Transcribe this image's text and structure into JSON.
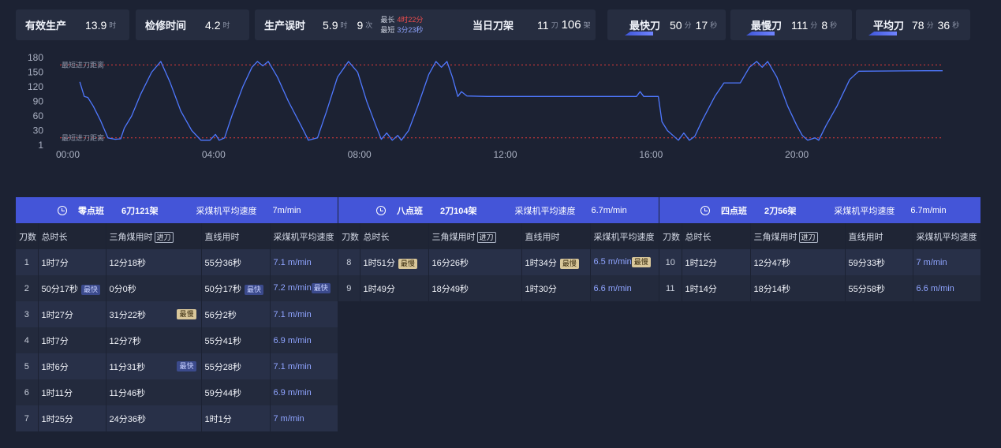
{
  "stats": {
    "effective": {
      "label": "有效生产",
      "value": "13.9",
      "unit": "时"
    },
    "maintenance": {
      "label": "检修时间",
      "value": "4.2",
      "unit": "时"
    },
    "delay": {
      "label": "生产误时",
      "value": "5.9",
      "unit": "时",
      "count": "9",
      "count_unit": "次",
      "longest_label": "最长",
      "longest": "4时22分",
      "shortest_label": "最短",
      "shortest": "3分23秒"
    },
    "today": {
      "label": "当日刀架",
      "knives": "11",
      "knives_unit": "刀",
      "frames": "106",
      "frames_unit": "架"
    },
    "fastest": {
      "label": "最快刀",
      "min": "50",
      "min_unit": "分",
      "sec": "17",
      "sec_unit": "秒"
    },
    "slowest": {
      "label": "最慢刀",
      "min": "111",
      "min_unit": "分",
      "sec": "8",
      "sec_unit": "秒"
    },
    "average": {
      "label": "平均刀",
      "min": "78",
      "min_unit": "分",
      "sec": "36",
      "sec_unit": "秒"
    }
  },
  "chart_data": {
    "type": "line",
    "yticks": [
      "180",
      "150",
      "120",
      "90",
      "60",
      "30",
      "1"
    ],
    "xticks": [
      "00:00",
      "04:00",
      "08:00",
      "12:00",
      "16:00",
      "20:00"
    ],
    "ylim": [
      0,
      180
    ],
    "xlim": [
      0,
      24
    ],
    "colors": {
      "line": "#4f78ff",
      "ref": "#e03a3a"
    },
    "ref_lines": [
      {
        "label": "最短进刀距离",
        "y": 165
      },
      {
        "label": "最短进刀距离",
        "y": 15
      }
    ],
    "series": [
      {
        "points": [
          [
            0.33,
            130
          ],
          [
            0.45,
            100
          ],
          [
            0.55,
            98
          ],
          [
            0.7,
            80
          ],
          [
            0.9,
            50
          ],
          [
            1.1,
            15
          ],
          [
            1.3,
            12
          ],
          [
            1.45,
            13
          ],
          [
            1.55,
            35
          ],
          [
            1.75,
            60
          ],
          [
            2.0,
            105
          ],
          [
            2.3,
            150
          ],
          [
            2.55,
            172
          ],
          [
            2.8,
            130
          ],
          [
            3.1,
            70
          ],
          [
            3.4,
            30
          ],
          [
            3.65,
            10
          ],
          [
            3.9,
            10
          ],
          [
            4.05,
            22
          ],
          [
            4.15,
            10
          ],
          [
            4.3,
            15
          ],
          [
            4.5,
            60
          ],
          [
            4.8,
            120
          ],
          [
            5.05,
            160
          ],
          [
            5.2,
            172
          ],
          [
            5.35,
            163
          ],
          [
            5.5,
            172
          ],
          [
            5.75,
            140
          ],
          [
            6.05,
            90
          ],
          [
            6.4,
            40
          ],
          [
            6.6,
            10
          ],
          [
            6.85,
            15
          ],
          [
            7.1,
            70
          ],
          [
            7.4,
            140
          ],
          [
            7.7,
            172
          ],
          [
            7.95,
            150
          ],
          [
            8.2,
            90
          ],
          [
            8.45,
            40
          ],
          [
            8.6,
            12
          ],
          [
            8.75,
            25
          ],
          [
            8.9,
            10
          ],
          [
            9.05,
            20
          ],
          [
            9.15,
            10
          ],
          [
            9.35,
            30
          ],
          [
            9.6,
            80
          ],
          [
            9.9,
            145
          ],
          [
            10.1,
            172
          ],
          [
            10.25,
            160
          ],
          [
            10.4,
            172
          ],
          [
            10.55,
            140
          ],
          [
            10.7,
            100
          ],
          [
            10.8,
            110
          ],
          [
            10.95,
            101
          ],
          [
            11.5,
            100
          ],
          [
            13.0,
            100
          ],
          [
            14.0,
            100
          ],
          [
            15.6,
            100
          ],
          [
            15.7,
            110
          ],
          [
            15.8,
            100
          ],
          [
            16.2,
            100
          ],
          [
            16.3,
            48
          ],
          [
            16.45,
            30
          ],
          [
            16.6,
            20
          ],
          [
            16.75,
            10
          ],
          [
            16.9,
            25
          ],
          [
            17.05,
            10
          ],
          [
            17.2,
            18
          ],
          [
            17.4,
            50
          ],
          [
            17.75,
            100
          ],
          [
            18.0,
            128
          ],
          [
            18.45,
            128
          ],
          [
            18.7,
            160
          ],
          [
            18.9,
            172
          ],
          [
            19.05,
            160
          ],
          [
            19.2,
            172
          ],
          [
            19.45,
            140
          ],
          [
            19.75,
            80
          ],
          [
            20.0,
            40
          ],
          [
            20.15,
            20
          ],
          [
            20.3,
            10
          ],
          [
            20.5,
            15
          ],
          [
            20.6,
            10
          ],
          [
            20.8,
            40
          ],
          [
            21.1,
            80
          ],
          [
            21.45,
            135
          ],
          [
            21.7,
            152
          ],
          [
            23.5,
            153
          ],
          [
            24.0,
            153
          ]
        ]
      }
    ]
  },
  "shifts": [
    {
      "name": "零点班",
      "count": "6刀121架",
      "speed_label": "采煤机平均速度",
      "speed": "7m/min"
    },
    {
      "name": "八点班",
      "count": "2刀104架",
      "speed_label": "采煤机平均速度",
      "speed": "6.7m/min"
    },
    {
      "name": "四点班",
      "count": "2刀56架",
      "speed_label": "采煤机平均速度",
      "speed": "6.7m/min"
    }
  ],
  "columns": {
    "idx": "刀数",
    "total": "总时长",
    "tri": "三角煤用时",
    "tri_tag": "进刀",
    "line": "直线用时",
    "speed": "采煤机平均速度"
  },
  "badges": {
    "fast": "最快",
    "slow": "最慢"
  },
  "rows0": [
    {
      "idx": "1",
      "total": "1时7分",
      "tri": "12分18秒",
      "line": "55分36秒",
      "speed": "7.1 m/min"
    },
    {
      "idx": "2",
      "total": "50分17秒",
      "tri": "0分0秒",
      "line": "50分17秒",
      "speed": "7.2 m/min"
    },
    {
      "idx": "3",
      "total": "1时27分",
      "tri": "31分22秒",
      "line": "56分2秒",
      "speed": "7.1 m/min"
    },
    {
      "idx": "4",
      "total": "1时7分",
      "tri": "12分7秒",
      "line": "55分41秒",
      "speed": "6.9 m/min"
    },
    {
      "idx": "5",
      "total": "1时6分",
      "tri": "11分31秒",
      "line": "55分28秒",
      "speed": "7.1 m/min"
    },
    {
      "idx": "6",
      "total": "1时11分",
      "tri": "11分46秒",
      "line": "59分44秒",
      "speed": "6.9 m/min"
    },
    {
      "idx": "7",
      "total": "1时25分",
      "tri": "24分36秒",
      "line": "1时1分",
      "speed": "7 m/min"
    }
  ],
  "rows1": [
    {
      "idx": "8",
      "total": "1时51分",
      "tri": "16分26秒",
      "line": "1时34分",
      "speed": "6.5 m/min"
    },
    {
      "idx": "9",
      "total": "1时49分",
      "tri": "18分49秒",
      "line": "1时30分",
      "speed": "6.6 m/min"
    }
  ],
  "rows2": [
    {
      "idx": "10",
      "total": "1时12分",
      "tri": "12分47秒",
      "line": "59分33秒",
      "speed": "7 m/min"
    },
    {
      "idx": "11",
      "total": "1时14分",
      "tri": "18分14秒",
      "line": "55分58秒",
      "speed": "6.6 m/min"
    }
  ]
}
